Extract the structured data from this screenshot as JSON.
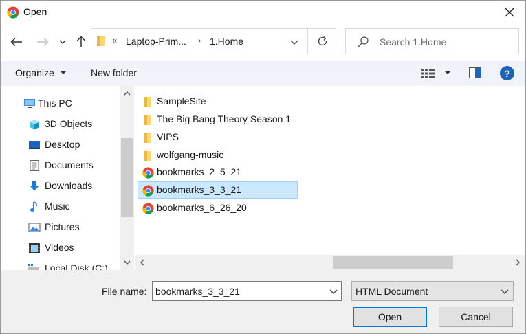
{
  "window": {
    "title": "Open",
    "app_icon": "chrome-icon",
    "close_icon": "close-icon"
  },
  "nav": {
    "back_icon": "arrow-left-icon",
    "forward_icon": "arrow-right-icon",
    "recent_icon": "chevron-down-icon",
    "up_icon": "arrow-up-icon"
  },
  "address": {
    "overflow": "«",
    "segments": [
      "Laptop-Prim...",
      "1.Home"
    ],
    "separator": "›",
    "refresh_icon": "refresh-icon"
  },
  "search": {
    "placeholder": "Search 1.Home",
    "value": ""
  },
  "toolbar": {
    "organize_label": "Organize",
    "new_folder_label": "New folder",
    "view_icon": "view-options-icon",
    "preview_icon": "preview-pane-icon",
    "help_label": "?"
  },
  "sidebar": {
    "items": [
      {
        "label": "This PC",
        "icon": "computer-icon"
      },
      {
        "label": "3D Objects",
        "icon": "cube-icon"
      },
      {
        "label": "Desktop",
        "icon": "desktop-icon"
      },
      {
        "label": "Documents",
        "icon": "document-icon"
      },
      {
        "label": "Downloads",
        "icon": "download-icon"
      },
      {
        "label": "Music",
        "icon": "music-icon"
      },
      {
        "label": "Pictures",
        "icon": "pictures-icon"
      },
      {
        "label": "Videos",
        "icon": "video-icon"
      },
      {
        "label": "Local Disk (C:)",
        "icon": "disk-icon"
      }
    ]
  },
  "files": {
    "items": [
      {
        "label": "SampleSite",
        "icon": "folder-icon",
        "selected": false
      },
      {
        "label": "The Big Bang Theory Season 1",
        "icon": "folder-icon",
        "selected": false
      },
      {
        "label": "VIPS",
        "icon": "folder-icon",
        "selected": false
      },
      {
        "label": "wolfgang-music",
        "icon": "folder-icon",
        "selected": false
      },
      {
        "label": "bookmarks_2_5_21",
        "icon": "chrome-html-icon",
        "selected": false
      },
      {
        "label": "bookmarks_3_3_21",
        "icon": "chrome-html-icon",
        "selected": true
      },
      {
        "label": "bookmarks_6_26_20",
        "icon": "chrome-html-icon",
        "selected": false
      }
    ]
  },
  "bottom": {
    "file_name_label": "File name:",
    "file_name_value": "bookmarks_3_3_21",
    "file_type_value": "HTML Document",
    "open_label": "Open",
    "cancel_label": "Cancel"
  },
  "colors": {
    "selection_bg": "#cce8ff",
    "selection_border": "#99d1ff",
    "accent": "#0078d7",
    "toolbar_bg": "#f0f3f9",
    "folder": "#f8d775"
  }
}
